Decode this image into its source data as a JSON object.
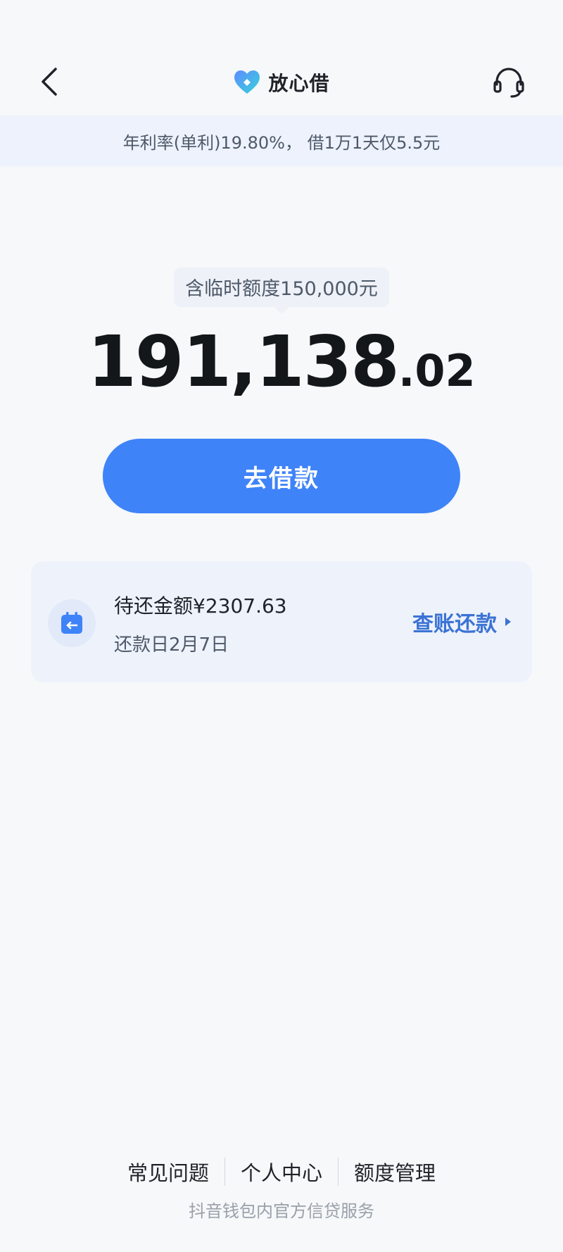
{
  "header": {
    "brand_name": "放心借"
  },
  "banner": {
    "rate_text": "年利率(单利)19.80%， 借1万1天仅5.5元"
  },
  "credit": {
    "temp_quota_text": "含临时额度150,000元",
    "available_integer": "191,138",
    "available_decimal": ".02"
  },
  "actions": {
    "borrow_label": "去借款"
  },
  "repayment": {
    "due_amount_text": "待还金额¥2307.63",
    "due_date_text": "还款日2月7日",
    "view_label": "查账还款"
  },
  "footer": {
    "items": [
      {
        "label": "常见问题"
      },
      {
        "label": "个人中心"
      },
      {
        "label": "额度管理"
      }
    ],
    "note": "抖音钱包内官方信贷服务"
  },
  "icons": {
    "back": "back-arrow-icon",
    "service": "headset-icon",
    "brand_logo": "heart-logo-icon",
    "calendar": "calendar-icon",
    "chevron": "triangle-right-icon"
  },
  "colors": {
    "primary": "#3f83f8",
    "link": "#3b73d4",
    "background": "#f6f8fa",
    "banner": "#edf2fc"
  }
}
